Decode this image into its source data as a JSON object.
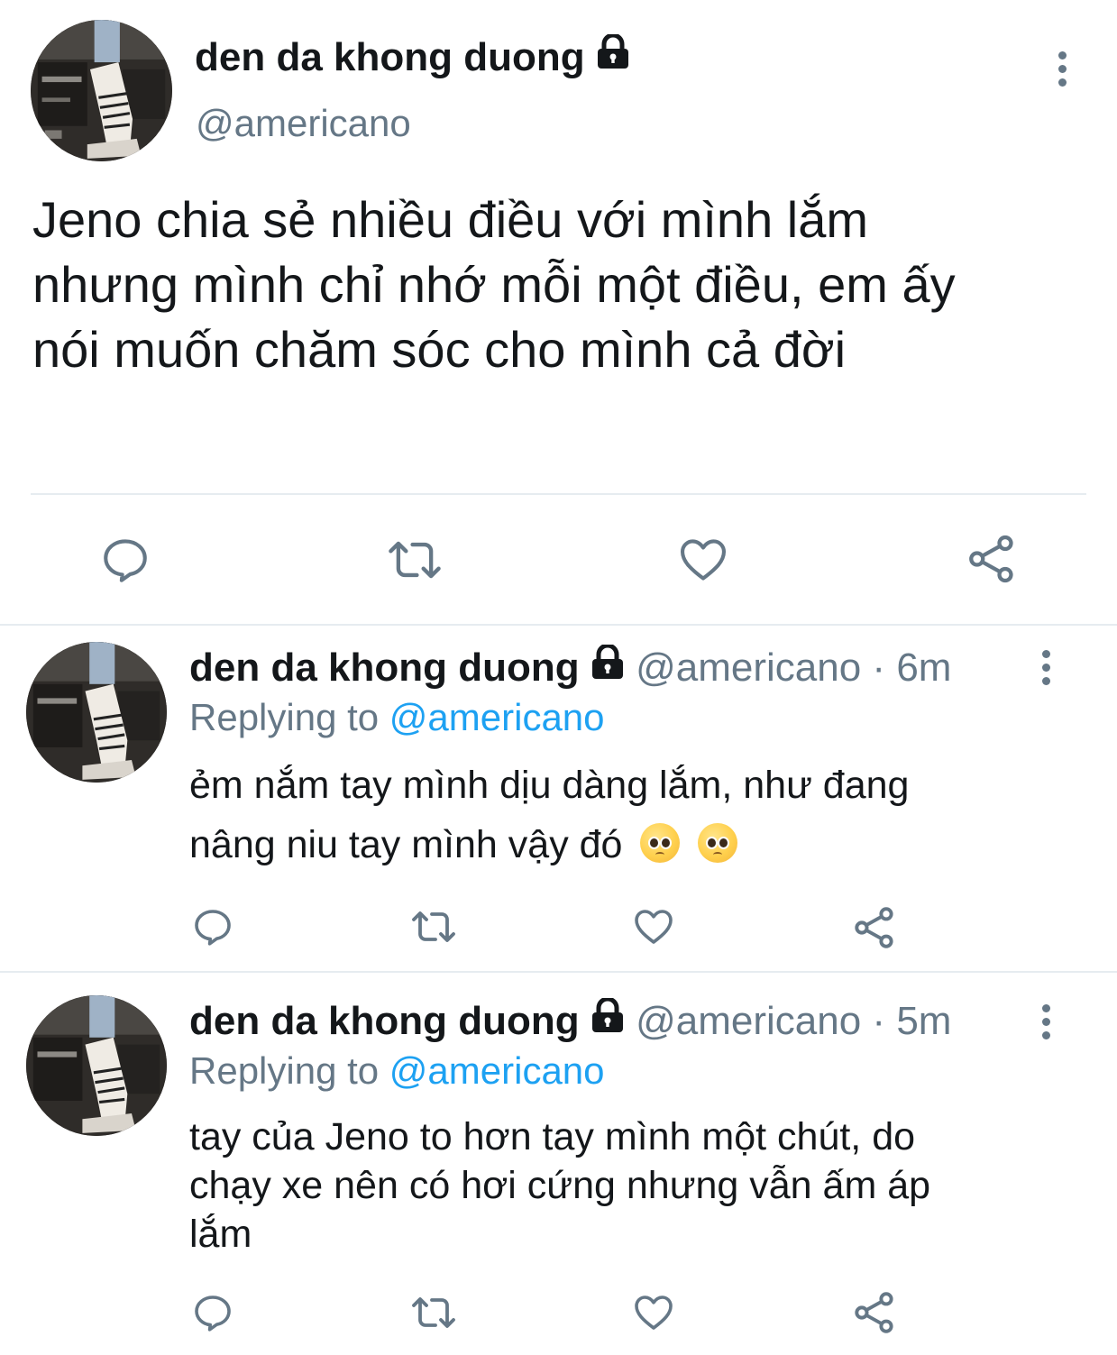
{
  "main_tweet": {
    "display_name": "den da khong duong",
    "handle": "@americano",
    "text_lines": [
      "Jeno chia sẻ nhiều điều với mình lắm",
      "nhưng mình chỉ nhớ mỗi một điều, em ấy",
      "nói muốn chăm sóc cho mình cả đời"
    ]
  },
  "replies": [
    {
      "display_name": "den da khong duong",
      "handle": "@americano",
      "separator": "·",
      "time": "6m",
      "replying_prefix": "Replying to",
      "replying_to": "@americano",
      "text_lines": [
        "ẻm nắm tay mình dịu dàng lắm, như đang",
        "nâng niu tay mình vậy đó"
      ],
      "emojis": [
        "pleading-face",
        "pleading-face"
      ]
    },
    {
      "display_name": "den da khong duong",
      "handle": "@americano",
      "separator": "·",
      "time": "5m",
      "replying_prefix": "Replying to",
      "replying_to": "@americano",
      "text_lines": [
        "tay của Jeno to hơn tay mình một chút, do",
        "chạy xe nên có hơi cứng nhưng vẫn ấm áp",
        "lắm"
      ]
    }
  ],
  "actions": [
    "reply-icon",
    "retweet-icon",
    "like-icon",
    "share-icon"
  ],
  "colors": {
    "text": "#14171a",
    "secondary": "#657786",
    "link": "#1da1f2",
    "divider": "#e6ecf0"
  }
}
